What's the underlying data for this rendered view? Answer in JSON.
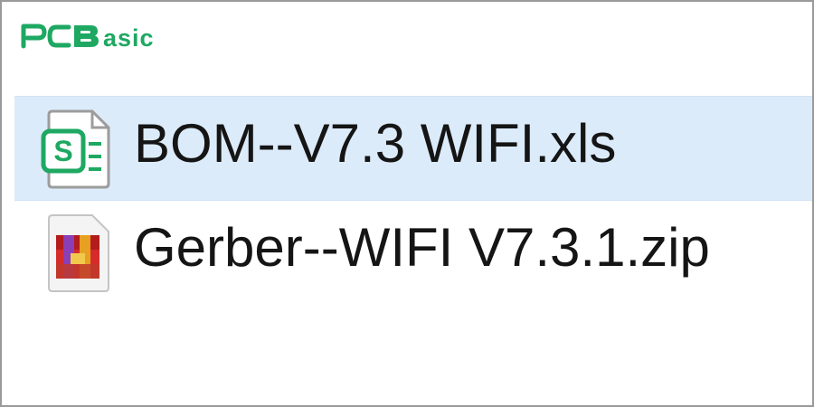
{
  "logo": {
    "text": "PC Basic",
    "brand_color": "#1ea862"
  },
  "files": [
    {
      "name": "BOM--V7.3 WIFI.xls",
      "icon": "spreadsheet-icon",
      "icon_letter": "S",
      "selected": true
    },
    {
      "name": "Gerber--WIFI V7.3.1.zip",
      "icon": "archive-icon",
      "selected": false
    }
  ],
  "colors": {
    "selection_background": "#dcebfa",
    "text": "#151515",
    "border": "#9a9a9a"
  }
}
